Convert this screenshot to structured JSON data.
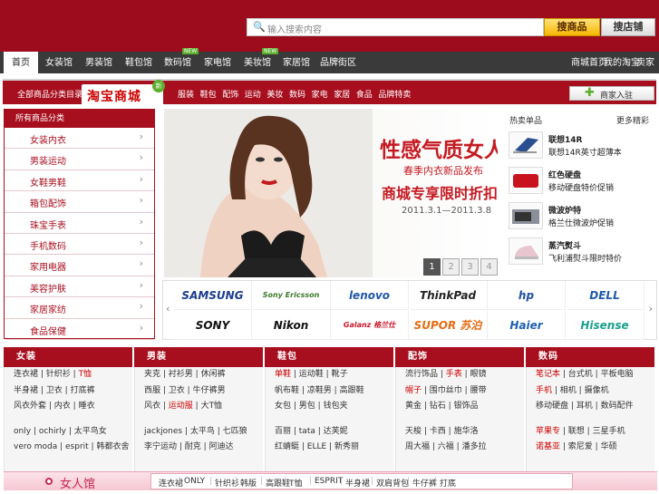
{
  "header": {
    "search_placeholder": "输入搜索内容",
    "search_goods_label": "搜商品",
    "search_shop_label": "搜店铺"
  },
  "nav": {
    "items": [
      {
        "label": "首页",
        "active": true,
        "badge": ""
      },
      {
        "label": "女装馆",
        "badge": ""
      },
      {
        "label": "男装馆",
        "badge": ""
      },
      {
        "label": "鞋包馆",
        "badge": ""
      },
      {
        "label": "数码馆",
        "badge": "NEW"
      },
      {
        "label": "家电馆",
        "badge": ""
      },
      {
        "label": "美妆馆",
        "badge": "NEW"
      },
      {
        "label": "家居馆",
        "badge": ""
      },
      {
        "label": "品牌街区",
        "badge": ""
      }
    ],
    "right_links": [
      "商城首页",
      "我的淘宝",
      "卖家中心"
    ]
  },
  "mall_bar": {
    "label": "全部商品分类目录",
    "logo_text": "淘宝商城",
    "logo_badge": "新",
    "categories": [
      "服装",
      "鞋包",
      "配饰",
      "运动",
      "美妆",
      "数码",
      "家电",
      "家居",
      "食品",
      "品牌特卖"
    ],
    "join_label": "商家入驻"
  },
  "left_panel": {
    "title": "所有商品分类",
    "items": [
      "女装内衣",
      "男装运动",
      "女鞋男鞋",
      "箱包配饰",
      "珠宝手表",
      "手机数码",
      "家用电器",
      "美容护肤",
      "家居家纺",
      "食品保健"
    ]
  },
  "banner": {
    "headline": "性感气质女人",
    "subline": "春季内衣新品发布",
    "promo": "商城专享限时折扣",
    "dates": "2011.3.1—2011.3.8",
    "pages": [
      "1",
      "2",
      "3",
      "4"
    ],
    "active_page": "1"
  },
  "right_panel": {
    "title": "热卖单品",
    "more": "更多精彩",
    "products": [
      {
        "name": "联想14R",
        "desc": "联想14R英寸超薄本"
      },
      {
        "name": "红色硬盘",
        "desc": "移动硬盘特价促销"
      },
      {
        "name": "微波炉特",
        "desc": "格兰仕微波炉促销"
      },
      {
        "name": "蒸汽熨斗",
        "desc": "飞利浦熨斗限时特价"
      }
    ]
  },
  "brands": {
    "row1": [
      {
        "name": "SAMSUNG",
        "color": "#1a3d8f"
      },
      {
        "name": "Sony Ericsson",
        "color": "#3a7a2a"
      },
      {
        "name": "lenovo",
        "color": "#1e56a8"
      },
      {
        "name": "ThinkPad",
        "color": "#222222"
      },
      {
        "name": "hp",
        "color": "#1e4fa3"
      },
      {
        "name": "DELL",
        "color": "#1d5aa8"
      }
    ],
    "row2": [
      {
        "name": "SONY",
        "color": "#111111"
      },
      {
        "name": "Nikon",
        "color": "#111111"
      },
      {
        "name": "Galanz 格兰仕",
        "color": "#c8162a"
      },
      {
        "name": "SUPOR 苏泊尔",
        "color": "#e46c12"
      },
      {
        "name": "Haier",
        "color": "#1f5fb0"
      },
      {
        "name": "Hisense",
        "color": "#1aa08c"
      }
    ]
  },
  "columns": [
    {
      "title": "女装",
      "lines": [
        [
          {
            "t": "连衣裙"
          },
          {
            "t": "针织衫"
          },
          {
            "t": "T恤",
            "red": true
          }
        ],
        [
          {
            "t": "半身裙"
          },
          {
            "t": "卫衣"
          },
          {
            "t": "打底裤"
          }
        ],
        [
          {
            "t": "风衣外套"
          },
          {
            "t": "内衣"
          },
          {
            "t": "睡衣"
          }
        ],
        [],
        [
          {
            "t": "only"
          },
          {
            "t": "ochirly"
          },
          {
            "t": "太平鸟女"
          }
        ],
        [
          {
            "t": "vero moda"
          },
          {
            "t": "esprit"
          },
          {
            "t": "韩都衣舍"
          }
        ]
      ]
    },
    {
      "title": "男装",
      "lines": [
        [
          {
            "t": "夹克"
          },
          {
            "t": "衬衫男"
          },
          {
            "t": "休闲裤"
          }
        ],
        [
          {
            "t": "西服"
          },
          {
            "t": "卫衣"
          },
          {
            "t": "牛仔裤男"
          }
        ],
        [
          {
            "t": "风衣"
          },
          {
            "t": "运动服",
            "red": true
          },
          {
            "t": "大T恤"
          }
        ],
        [],
        [
          {
            "t": "jackjones"
          },
          {
            "t": "太平鸟"
          },
          {
            "t": "七匹狼"
          }
        ],
        [
          {
            "t": "李宁运动"
          },
          {
            "t": "耐克"
          },
          {
            "t": "阿迪达"
          }
        ]
      ]
    },
    {
      "title": "鞋包",
      "lines": [
        [
          {
            "t": "单鞋",
            "red": true
          },
          {
            "t": "运动鞋"
          },
          {
            "t": "靴子"
          }
        ],
        [
          {
            "t": "帆布鞋"
          },
          {
            "t": "凉鞋男"
          },
          {
            "t": "高跟鞋"
          }
        ],
        [
          {
            "t": "女包"
          },
          {
            "t": "男包"
          },
          {
            "t": "钱包夹"
          }
        ],
        [],
        [
          {
            "t": "百丽"
          },
          {
            "t": "tata"
          },
          {
            "t": "达芙妮"
          }
        ],
        [
          {
            "t": "红蜻蜓"
          },
          {
            "t": "ELLE"
          },
          {
            "t": "新秀丽"
          }
        ]
      ]
    },
    {
      "title": "配饰",
      "lines": [
        [
          {
            "t": "流行饰品"
          },
          {
            "t": "手表",
            "red": true
          },
          {
            "t": "眼镜"
          }
        ],
        [
          {
            "t": "帽子",
            "red": true
          },
          {
            "t": "围巾丝巾"
          },
          {
            "t": "腰带"
          }
        ],
        [
          {
            "t": "黄金"
          },
          {
            "t": "钻石"
          },
          {
            "t": "银饰品"
          }
        ],
        [],
        [
          {
            "t": "天梭"
          },
          {
            "t": "卡西"
          },
          {
            "t": "施华洛"
          }
        ],
        [
          {
            "t": "周大福"
          },
          {
            "t": "六福"
          },
          {
            "t": "潘多拉"
          }
        ]
      ]
    },
    {
      "title": "数码",
      "lines": [
        [
          {
            "t": "笔记本",
            "red": true
          },
          {
            "t": "台式机"
          },
          {
            "t": "平板电脑"
          }
        ],
        [
          {
            "t": "手机",
            "red": true
          },
          {
            "t": "相机"
          },
          {
            "t": "摄像机"
          }
        ],
        [
          {
            "t": "移动硬盘"
          },
          {
            "t": "耳机"
          },
          {
            "t": "数码配件"
          }
        ],
        [],
        [
          {
            "t": "苹果专",
            "red": true
          },
          {
            "t": "联想"
          },
          {
            "t": "三星手机"
          }
        ],
        [
          {
            "t": "诺基亚",
            "red": true
          },
          {
            "t": "索尼爱"
          },
          {
            "t": "华硕"
          }
        ]
      ]
    }
  ],
  "women_bar": {
    "title": "女人馆",
    "links": [
      "连衣裙",
      "ONLY",
      "针织衫",
      "韩版",
      "高跟鞋",
      "T恤",
      "ESPRIT",
      "半身裙",
      "双肩背包",
      "牛仔裤",
      "打底"
    ]
  }
}
